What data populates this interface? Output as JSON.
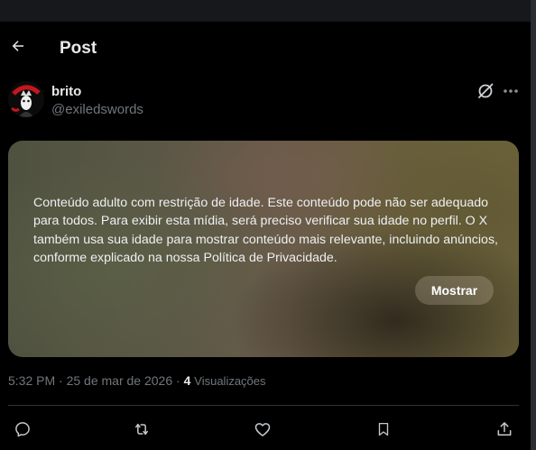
{
  "header": {
    "title": "Post"
  },
  "author": {
    "display_name": "brito",
    "handle": "@exiledswords"
  },
  "media": {
    "warning": "Conteúdo adulto com restrição de idade. Este conteúdo pode não ser adequado para todos. Para exibir esta mídia, será preciso verificar sua idade no perfil. O X também usa sua idade para mostrar conteúdo mais relevante, incluindo anúncios, conforme explicado na nossa Política de Privacidade.",
    "show_label": "Mostrar"
  },
  "meta": {
    "time": "5:32 PM",
    "separator": " · ",
    "date": "25 de mar de 2026",
    "views_count": "4",
    "views_label": "Visualizações"
  },
  "icons": {
    "back": "arrow-left-icon",
    "grok": "grok-icon",
    "more": "more-icon",
    "reply": "reply-icon",
    "repost": "repost-icon",
    "like": "heart-icon",
    "bookmark": "bookmark-icon",
    "share": "share-icon"
  },
  "colors": {
    "background": "#000000",
    "text": "#e7e9ea",
    "muted": "#71767b",
    "divider": "#2f3336"
  }
}
